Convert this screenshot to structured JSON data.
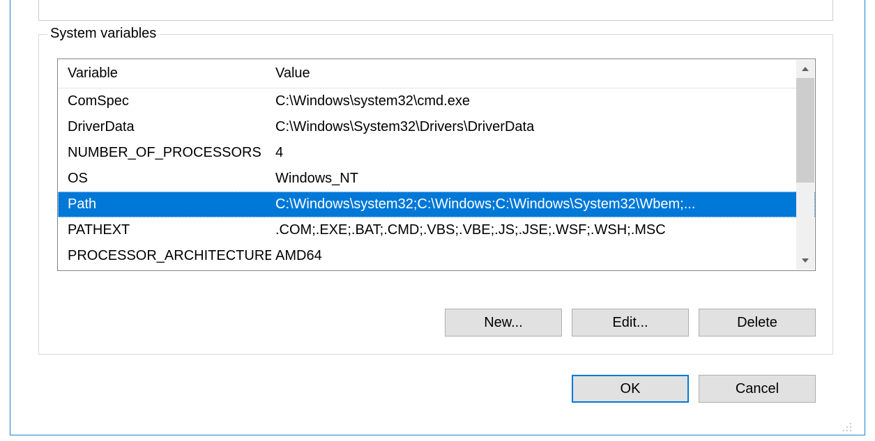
{
  "groupbox": {
    "title": "System variables"
  },
  "listview": {
    "headers": {
      "variable": "Variable",
      "value": "Value"
    },
    "selectedIndex": 4,
    "rows": [
      {
        "variable": "ComSpec",
        "value": "C:\\Windows\\system32\\cmd.exe"
      },
      {
        "variable": "DriverData",
        "value": "C:\\Windows\\System32\\Drivers\\DriverData"
      },
      {
        "variable": "NUMBER_OF_PROCESSORS",
        "value": "4"
      },
      {
        "variable": "OS",
        "value": "Windows_NT"
      },
      {
        "variable": "Path",
        "value": "C:\\Windows\\system32;C:\\Windows;C:\\Windows\\System32\\Wbem;..."
      },
      {
        "variable": "PATHEXT",
        "value": ".COM;.EXE;.BAT;.CMD;.VBS;.VBE;.JS;.JSE;.WSF;.WSH;.MSC"
      },
      {
        "variable": "PROCESSOR_ARCHITECTURE",
        "value": "AMD64"
      }
    ]
  },
  "buttons": {
    "new": "New...",
    "edit": "Edit...",
    "delete": "Delete",
    "ok": "OK",
    "cancel": "Cancel"
  }
}
